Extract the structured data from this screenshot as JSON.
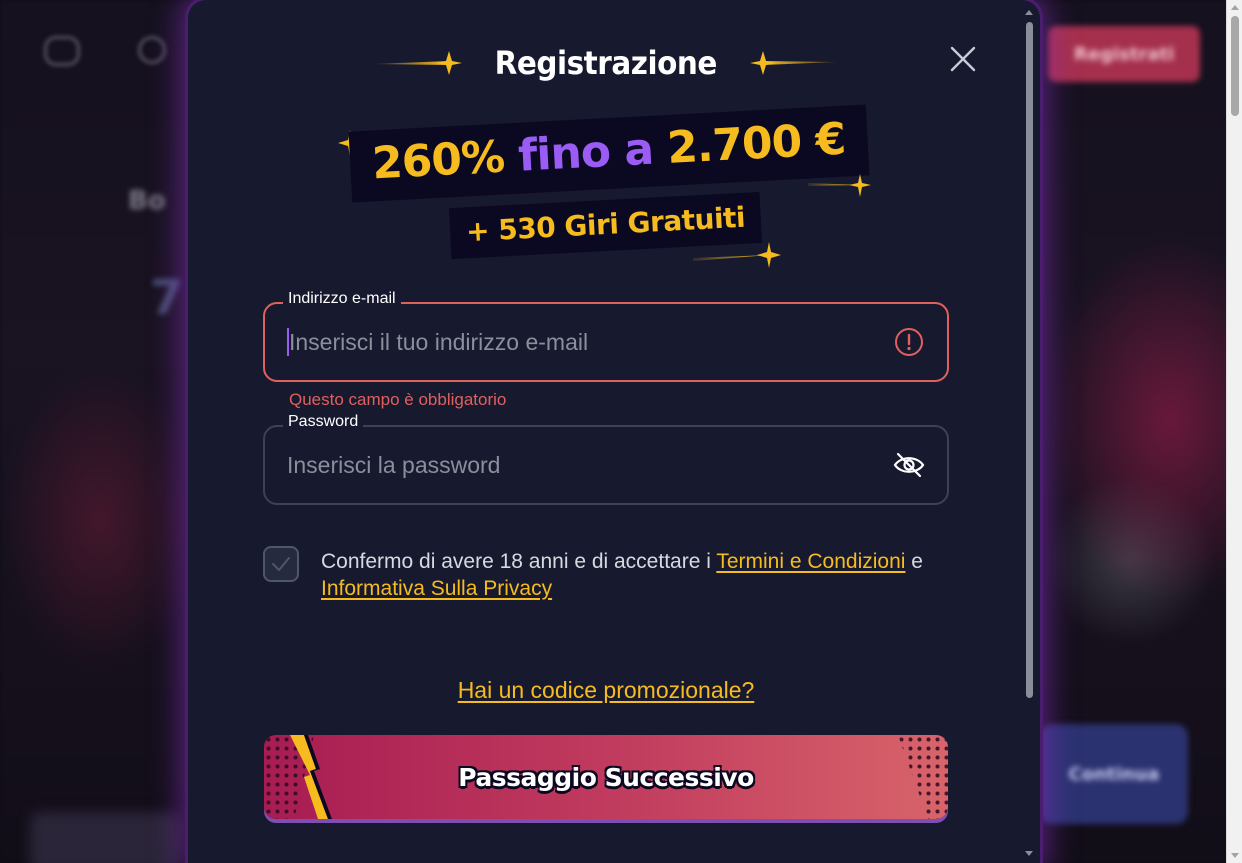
{
  "background": {
    "header_register_label": "Registrati",
    "continue_label": "Continua"
  },
  "modal": {
    "title": "Registrazione",
    "promo": {
      "percent": "260%",
      "middle": "fino a",
      "amount": "2.700 €",
      "spins": "+ 530 Giri Gratuiti"
    },
    "email": {
      "label": "Indirizzo e-mail",
      "placeholder": "Inserisci il tuo indirizzo e-mail",
      "value": "",
      "error": "Questo campo è obbligatorio",
      "status_icon": "alert-circle-icon"
    },
    "password": {
      "label": "Password",
      "placeholder": "Inserisci la password",
      "value": "",
      "toggle_icon": "eye-off-icon"
    },
    "consent": {
      "checked": false,
      "text_before": "Confermo di avere 18 anni e di accettare i ",
      "terms_link": "Termini e Condizioni",
      "text_middle": " e",
      "privacy_link": "Informativa Sulla Privacy"
    },
    "promo_code_link": "Hai un codice promozionale?",
    "next_button": "Passaggio Successivo"
  },
  "colors": {
    "modal_bg": "#171a2e",
    "accent_yellow": "#f6bb1e",
    "accent_purple": "#9a5cf5",
    "error_red": "#e0605e",
    "button_gradient_start": "#a81c52",
    "button_gradient_end": "#d8646a"
  }
}
